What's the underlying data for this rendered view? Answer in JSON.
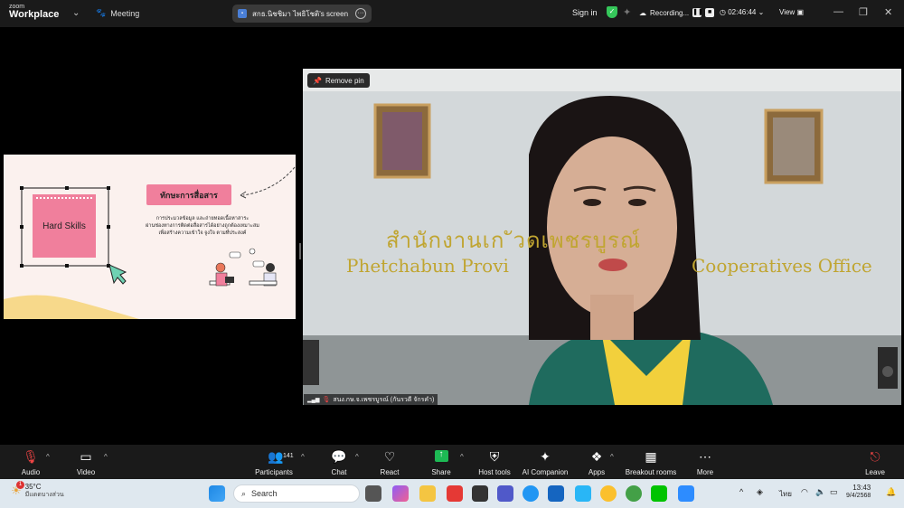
{
  "app": {
    "logo_small": "zoom",
    "logo_big": "Workplace",
    "meeting_label": "Meeting",
    "share_title": "สกธ.นิชชิมา  ไพธิโชติ's screen",
    "sign_in": "Sign in",
    "recording_label": "Recording...",
    "timer": "02:46:44",
    "view_label": "View"
  },
  "slide": {
    "box_label": "Hard Skills",
    "heading": "ทักษะการสื่อสาร",
    "body_line1": "การประมวลข้อมูล และถ่ายทอดเนื้อหาสาระ",
    "body_line2": "ผ่านช่องทางการติดต่อสื่อสารได้อย่างถูกต้องเหมาะสม",
    "body_line3": "เพื่อสร้างความเข้าใจ จูงใจ ตามที่ประสงค์",
    "accent_color": "#f07f9c"
  },
  "video": {
    "remove_pin": "Remove pin",
    "sign_thai": "สำนักงานเก  ัวดเพชรบูรณ์",
    "sign_en_left": "Phetchabun Provi",
    "sign_en_right": "Cooperatives Office",
    "participant_name": "สนง.กษ.จ.เพชรบูรณ์ (กันรวดี จักรคำ)"
  },
  "toolbar": {
    "audio": "Audio",
    "video": "Video",
    "participants": "Participants",
    "participants_count": "141",
    "chat": "Chat",
    "react": "React",
    "share": "Share",
    "host_tools": "Host tools",
    "ai_companion": "AI Companion",
    "apps": "Apps",
    "breakout_rooms": "Breakout rooms",
    "more": "More",
    "leave": "Leave"
  },
  "taskbar": {
    "weather_temp": "35°C",
    "weather_desc": "มีแดดบางส่วน",
    "weather_badge": "1",
    "search_placeholder": "Search",
    "lang": "ไทย",
    "time": "13:43",
    "date": "9/4/2568"
  }
}
